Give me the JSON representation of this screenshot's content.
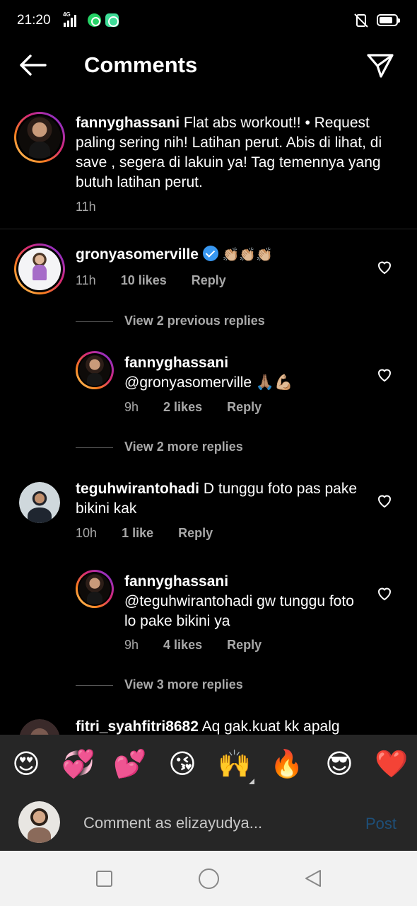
{
  "status_bar": {
    "time": "21:20",
    "network": "4G",
    "icons": [
      "signal-icon",
      "whatsapp-icon",
      "chat-app-icon",
      "mute-icon",
      "battery-icon"
    ]
  },
  "header": {
    "title": "Comments",
    "back_icon": "arrow-left-icon",
    "share_icon": "paper-plane-icon"
  },
  "caption": {
    "username": "fannyghassani",
    "text": "Flat abs workout!! • Request paling sering nih! Latihan perut. Abis di lihat, di save , segera di lakuin ya! Tag temennya yang butuh latihan perut.",
    "time": "11h"
  },
  "comments": [
    {
      "username": "gronyasomerville",
      "verified": true,
      "text": "👏🏼👏🏼👏🏼",
      "time": "11h",
      "likes": "10 likes",
      "reply_label": "Reply"
    },
    {
      "view_previous_label": "View 2 previous replies",
      "reply": {
        "username": "fannyghassani",
        "text": "@gronyasomerville 🙏🏽💪🏼",
        "time": "9h",
        "likes": "2 likes",
        "reply_label": "Reply"
      },
      "view_more_label": "View 2 more replies"
    },
    {
      "username": "teguhwirantohadi",
      "text": "D tunggu foto pas pake bikini kak",
      "time": "10h",
      "likes": "1 like",
      "reply_label": "Reply"
    },
    {
      "reply": {
        "username": "fannyghassani",
        "text": "@teguhwirantohadi gw tunggu foto lo pake bikini ya",
        "time": "9h",
        "likes": "4 likes",
        "reply_label": "Reply"
      },
      "view_more_label": "View 3 more replies"
    },
    {
      "username": "fitri_syahfitri8682",
      "text": "Aq gak.kuat kk apalg"
    }
  ],
  "emoji_bar": [
    "😍",
    "💞",
    "💕",
    "😘",
    "🙌",
    "🔥",
    "😎",
    "❤️"
  ],
  "composer": {
    "placeholder": "Comment as elizayudya...",
    "post_label": "Post"
  },
  "colors": {
    "background": "#000000",
    "secondary_text": "#a8a8a8",
    "verified": "#3897f0",
    "post_disabled": "#1e4f79",
    "composer_bg": "#262626"
  }
}
